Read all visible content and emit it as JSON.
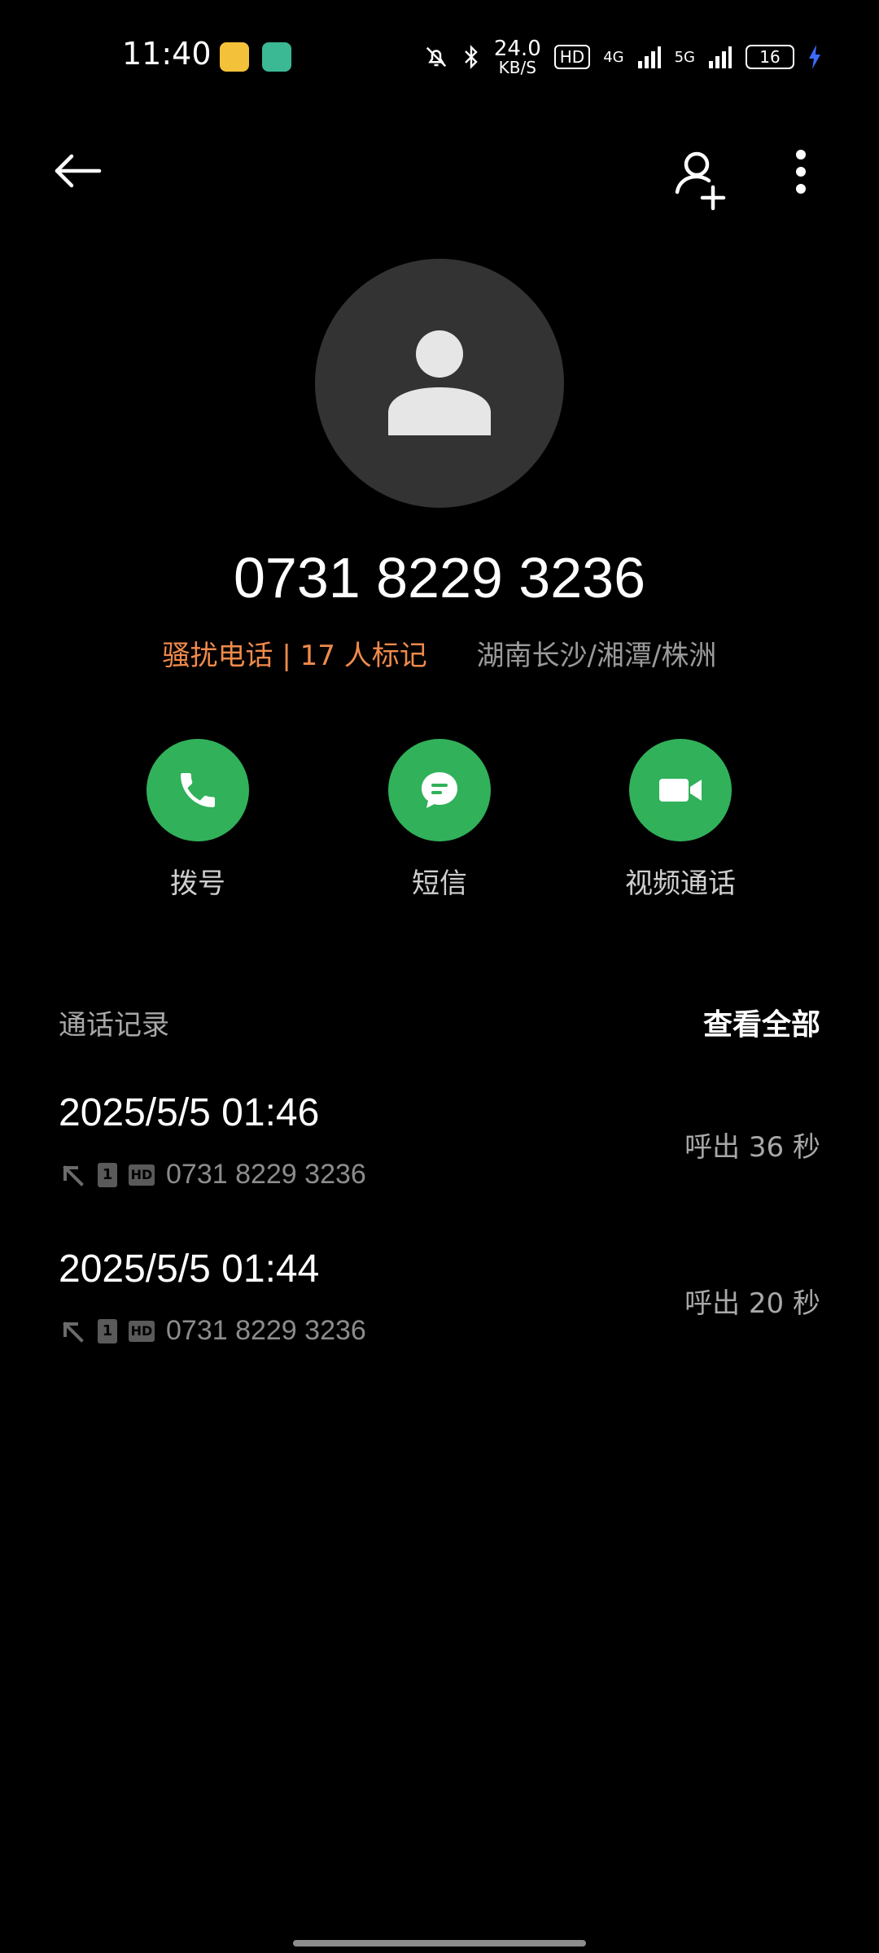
{
  "status_bar": {
    "time": "11:40",
    "net_speed_value": "24.0",
    "net_speed_unit": "KB/S",
    "hd_badge": "HD",
    "signal1_label": "4G",
    "signal2_label": "5G",
    "battery": "16",
    "icons": [
      "mute-bell-icon",
      "bluetooth-icon",
      "signal-icon",
      "battery-icon",
      "charging-icon"
    ]
  },
  "contact": {
    "number": "0731 8229 3236",
    "spam_tag": "骚扰电话 | 17 人标记",
    "location": "湖南长沙/湘潭/株洲"
  },
  "actions": [
    {
      "label": "拨号",
      "icon": "phone-icon"
    },
    {
      "label": "短信",
      "icon": "message-icon"
    },
    {
      "label": "视频通话",
      "icon": "video-icon"
    }
  ],
  "call_log": {
    "title": "通话记录",
    "view_all": "查看全部",
    "records": [
      {
        "datetime": "2025/5/5 01:46",
        "sim": "1",
        "hd": "HD",
        "number": "0731 8229 3236",
        "summary": "呼出  36 秒"
      },
      {
        "datetime": "2025/5/5 01:44",
        "sim": "1",
        "hd": "HD",
        "number": "0731 8229 3236",
        "summary": "呼出  20 秒"
      }
    ]
  },
  "colors": {
    "accent_green": "#31b15a",
    "spam_orange": "#f08a4b",
    "avatar_bg": "#333333"
  }
}
